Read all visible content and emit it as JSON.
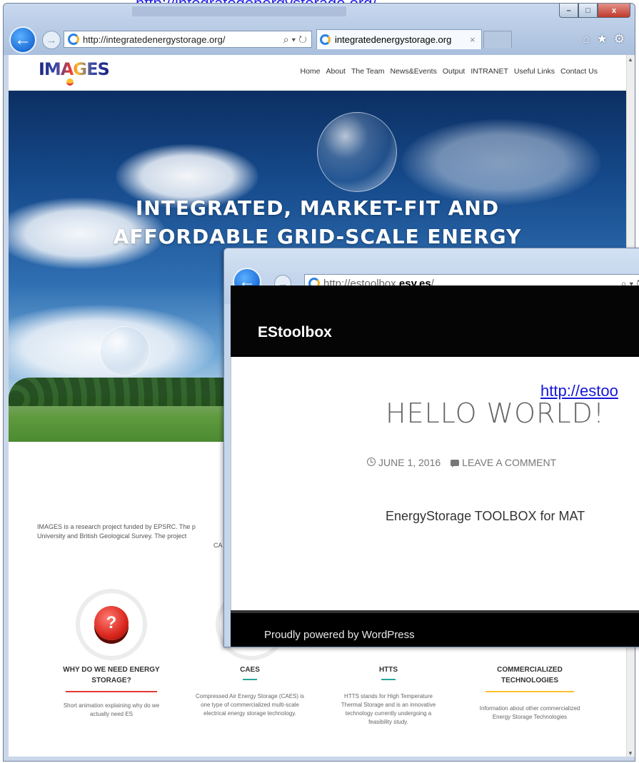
{
  "caption": "http://integratedenergystorage.org/",
  "window1": {
    "address_url": "http://integratedenergystorage.org/",
    "tab_title": "integratedenergystorage.org",
    "tab_close": "×",
    "controls": {
      "minimize": "–",
      "maximize": "□",
      "close": "x"
    },
    "toolbar_icons": {
      "home": "⌂",
      "favorites": "★",
      "settings": "⚙"
    },
    "address_tools": "⌕ ▾ ↻"
  },
  "site": {
    "logo": "IMAGES",
    "nav": [
      "Home",
      "About",
      "The Team",
      "News&Events",
      "Output",
      "INTRANET",
      "Useful Links",
      "Contact Us"
    ],
    "hero_title_line1": "INTEGRATED, MARKET-FIT AND",
    "hero_title_line2": "AFFORDABLE GRID-SCALE ENERGY",
    "about_line1": "IMAGES is a research project funded by EPSRC. The p",
    "about_line2": "University and British Geological Survey. The project",
    "about_line3": "CA",
    "features": [
      {
        "title_line1": "WHY DO WE NEED ENERGY",
        "title_line2": "STORAGE?",
        "desc_line1": "Short animation explaining why do we",
        "desc_line2": "actually need ES",
        "rule_color": "#e53935"
      },
      {
        "title_line1": "CAES",
        "title_line2": "",
        "desc_line1": "Compressed Air Energy Storage (CAES) is",
        "desc_line2": "one type of commercialized multi-scale",
        "desc_line3": "electrical energy storage technology.",
        "rule_color": "#26a69a"
      },
      {
        "title_line1": "HTTS",
        "title_line2": "",
        "desc_line1": "HTTS stands for High Temperature",
        "desc_line2": "Thermal Storage and is an innovative",
        "desc_line3": "technology currently undergoing a",
        "desc_line4": "feasibility study.",
        "rule_color": "#26a69a"
      },
      {
        "title_line1": "COMMERCIALIZED",
        "title_line2": "TECHNOLOGIES",
        "desc_line1": "Information about other commercialized",
        "desc_line2": "Energy Storage Technologies",
        "rule_color": "#fbc02d"
      }
    ]
  },
  "window2": {
    "address_url_prefix": "http://estoolbox.",
    "address_url_bold": "esy.es",
    "address_url_suffix": "/",
    "address_tools": "⌕ ▾ ↻"
  },
  "estoolbox": {
    "brand": "EStoolbox",
    "link": "http://estoo",
    "heading": "HELLO WORLD!",
    "date": "JUNE 1, 2016",
    "comment": "LEAVE A COMMENT",
    "body": "EnergyStorage TOOLBOX for MAT",
    "footer": "Proudly powered by WordPress"
  },
  "colors": {
    "ie_blue": "#1d6ed8",
    "titlebar": "#b8cce6",
    "link_blue": "#1515d8"
  }
}
